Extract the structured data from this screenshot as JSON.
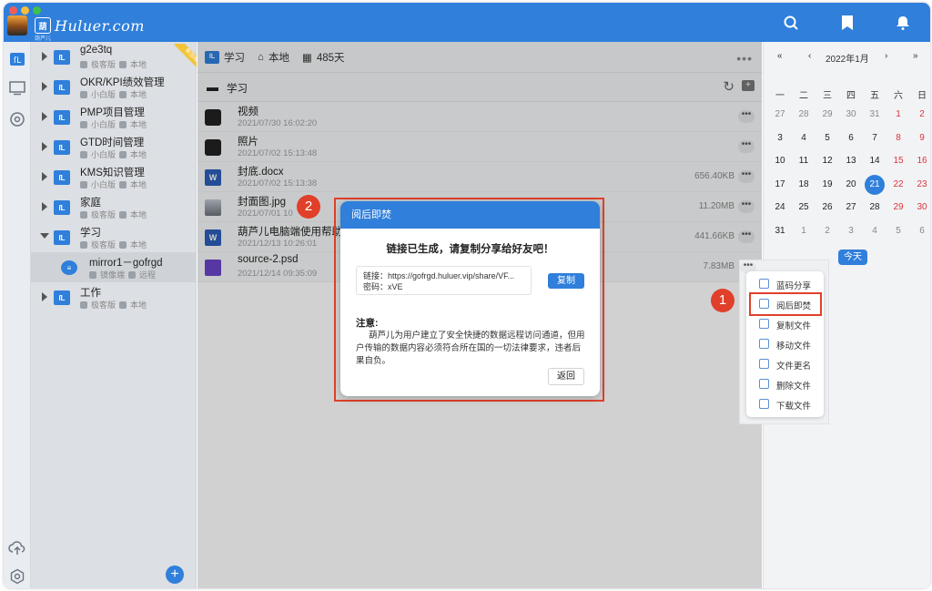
{
  "app": {
    "logo_text": "Huluer.com",
    "logo_sub": "葫芦儿",
    "logo_mark": "葫"
  },
  "colors": {
    "brand": "#2f7fdb",
    "traffic": [
      "#f25e56",
      "#f6bd3b",
      "#3fc14b"
    ],
    "highlight": "#e0402a"
  },
  "tree": [
    {
      "title": "g2e3tq",
      "edition": "极客版",
      "location": "本地",
      "ribbon": "新加坡"
    },
    {
      "title": "OKR/KPI绩效管理",
      "edition": "小白版",
      "location": "本地"
    },
    {
      "title": "PMP项目管理",
      "edition": "小白版",
      "location": "本地"
    },
    {
      "title": "GTD时间管理",
      "edition": "小白版",
      "location": "本地"
    },
    {
      "title": "KMS知识管理",
      "edition": "小白版",
      "location": "本地"
    },
    {
      "title": "家庭",
      "edition": "极客版",
      "location": "本地"
    },
    {
      "title": "学习",
      "edition": "极客版",
      "location": "本地"
    },
    {
      "title": "mirror1－gofrgd",
      "edition": "镜像端",
      "location": "远程"
    },
    {
      "title": "工作",
      "edition": "极客版",
      "location": "本地"
    }
  ],
  "crumbs": {
    "space": "学习",
    "location": "本地",
    "days": "485天"
  },
  "folder": {
    "name": "学习"
  },
  "files": [
    {
      "name": "视频",
      "date": "2021/07/30 16:02:20",
      "size": ""
    },
    {
      "name": "照片",
      "date": "2021/07/02 15:13:48",
      "size": ""
    },
    {
      "name": "封底.docx",
      "date": "2021/07/02 15:13:38",
      "size": "656.40KB"
    },
    {
      "name": "封面图.jpg",
      "date": "2021/07/01 10",
      "size": "11.20MB"
    },
    {
      "name": "葫芦儿电脑端使用帮助.do",
      "date": "2021/12/13 10:26:01",
      "size": "441.66KB"
    },
    {
      "name": "source-2.psd",
      "date": "2021/12/14 09:35:09",
      "size": "7.83MB"
    }
  ],
  "calendar": {
    "nav_prev_year": "«",
    "nav_prev": "‹",
    "month": "2022年1月",
    "nav_next": "›",
    "nav_next_year": "»",
    "weekdays": [
      "一",
      "二",
      "三",
      "四",
      "五",
      "六",
      "日"
    ],
    "weeks": [
      [
        "27",
        "28",
        "29",
        "30",
        "31",
        "1",
        "2"
      ],
      [
        "3",
        "4",
        "5",
        "6",
        "7",
        "8",
        "9"
      ],
      [
        "10",
        "11",
        "12",
        "13",
        "14",
        "15",
        "16"
      ],
      [
        "17",
        "18",
        "19",
        "20",
        "21",
        "22",
        "23"
      ],
      [
        "24",
        "25",
        "26",
        "27",
        "28",
        "29",
        "30"
      ],
      [
        "31",
        "1",
        "2",
        "3",
        "4",
        "5",
        "6"
      ]
    ],
    "today_label": "今天",
    "today": "21"
  },
  "menu": [
    "蓝码分享",
    "阅后即焚",
    "复制文件",
    "移动文件",
    "文件更名",
    "删除文件",
    "下载文件"
  ],
  "dialog": {
    "title": "阅后即焚",
    "heading": "链接已生成，请复制分享给好友吧！",
    "link_line": "链接：https://gofrgd.huluer.vip/share/VF...",
    "password_line": "密码：xVE",
    "copy_label": "复制",
    "note_title": "注意:",
    "note_body": "葫芦儿为用户建立了安全快捷的数据远程访问通道，但用户传输的数据内容必须符合所在国的一切法律要求，违者后果自负。",
    "back_label": "返回"
  },
  "badges": {
    "one": "1",
    "two": "2"
  }
}
